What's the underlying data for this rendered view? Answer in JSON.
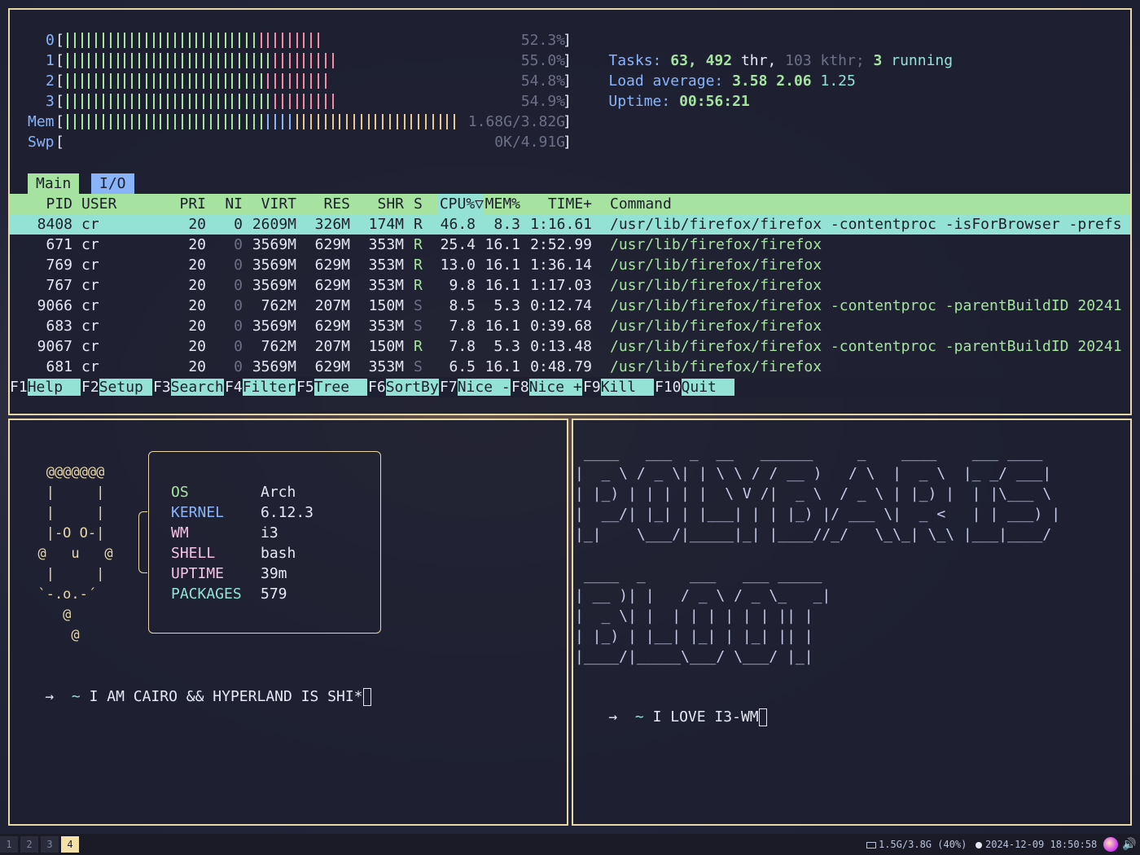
{
  "htop": {
    "cpus": [
      {
        "label": "0",
        "percent": "52.3%"
      },
      {
        "label": "1",
        "percent": "55.0%"
      },
      {
        "label": "2",
        "percent": "54.8%"
      },
      {
        "label": "3",
        "percent": "54.9%"
      }
    ],
    "mem": {
      "label": "Mem",
      "value": "1.68G/3.82G"
    },
    "swp": {
      "label": "Swp",
      "value": "0K/4.91G"
    },
    "tasks": {
      "label": "Tasks:",
      "count": "63,",
      "thr": "492",
      "thr_label": "thr,",
      "kthr": "103 kthr;",
      "running": "3",
      "running_label": "running"
    },
    "load": {
      "label": "Load average:",
      "one": "3.58",
      "five": "2.06",
      "fifteen": "1.25"
    },
    "uptime": {
      "label": "Uptime:",
      "value": "00:56:21"
    },
    "tabs": [
      "Main",
      "I/O"
    ],
    "columns": {
      "pid": "PID",
      "user": "USER",
      "pri": "PRI",
      "ni": "NI",
      "virt": "VIRT",
      "res": "RES",
      "shr": "SHR",
      "s": "S",
      "cpu": "CPU%▽",
      "mem": "MEM%",
      "time": "TIME+",
      "cmd": "Command"
    },
    "processes": [
      {
        "pid": "8408",
        "user": "cr",
        "pri": "20",
        "ni": "0",
        "virt": "2609M",
        "res": "326M",
        "shr": "174M",
        "s": "R",
        "cpu": "46.8",
        "mem": "8.3",
        "time": "1:16.61",
        "cmd": "/usr/lib/firefox/firefox -contentproc -isForBrowser -prefs"
      },
      {
        "pid": "671",
        "user": "cr",
        "pri": "20",
        "ni": "0",
        "virt": "3569M",
        "res": "629M",
        "shr": "353M",
        "s": "R",
        "cpu": "25.4",
        "mem": "16.1",
        "time": "2:52.99",
        "cmd": "/usr/lib/firefox/firefox"
      },
      {
        "pid": "769",
        "user": "cr",
        "pri": "20",
        "ni": "0",
        "virt": "3569M",
        "res": "629M",
        "shr": "353M",
        "s": "R",
        "cpu": "13.0",
        "mem": "16.1",
        "time": "1:36.14",
        "cmd": "/usr/lib/firefox/firefox"
      },
      {
        "pid": "767",
        "user": "cr",
        "pri": "20",
        "ni": "0",
        "virt": "3569M",
        "res": "629M",
        "shr": "353M",
        "s": "R",
        "cpu": "9.8",
        "mem": "16.1",
        "time": "1:17.03",
        "cmd": "/usr/lib/firefox/firefox"
      },
      {
        "pid": "9066",
        "user": "cr",
        "pri": "20",
        "ni": "0",
        "virt": "762M",
        "res": "207M",
        "shr": "150M",
        "s": "S",
        "cpu": "8.5",
        "mem": "5.3",
        "time": "0:12.74",
        "cmd": "/usr/lib/firefox/firefox -contentproc -parentBuildID 20241"
      },
      {
        "pid": "683",
        "user": "cr",
        "pri": "20",
        "ni": "0",
        "virt": "3569M",
        "res": "629M",
        "shr": "353M",
        "s": "S",
        "cpu": "7.8",
        "mem": "16.1",
        "time": "0:39.68",
        "cmd": "/usr/lib/firefox/firefox"
      },
      {
        "pid": "9067",
        "user": "cr",
        "pri": "20",
        "ni": "0",
        "virt": "762M",
        "res": "207M",
        "shr": "150M",
        "s": "R",
        "cpu": "7.8",
        "mem": "5.3",
        "time": "0:13.48",
        "cmd": "/usr/lib/firefox/firefox -contentproc -parentBuildID 20241"
      },
      {
        "pid": "681",
        "user": "cr",
        "pri": "20",
        "ni": "0",
        "virt": "3569M",
        "res": "629M",
        "shr": "353M",
        "s": "S",
        "cpu": "6.5",
        "mem": "16.1",
        "time": "0:48.79",
        "cmd": "/usr/lib/firefox/firefox"
      }
    ],
    "fkeys": [
      {
        "key": "F1",
        "label": "Help  "
      },
      {
        "key": "F2",
        "label": "Setup "
      },
      {
        "key": "F3",
        "label": "Search"
      },
      {
        "key": "F4",
        "label": "Filter"
      },
      {
        "key": "F5",
        "label": "Tree  "
      },
      {
        "key": "F6",
        "label": "SortBy"
      },
      {
        "key": "F7",
        "label": "Nice -"
      },
      {
        "key": "F8",
        "label": "Nice +"
      },
      {
        "key": "F9",
        "label": "Kill  "
      },
      {
        "key": "F10",
        "label": "Quit  "
      }
    ]
  },
  "neofetch": {
    "ascii": [
      "   @@@@@@@",
      "   |     |",
      "   |     |",
      "   |-O O-|",
      "  @   u   @",
      "   |     |",
      "  `-.o.-´",
      "     @",
      "      @"
    ],
    "info": [
      {
        "key": "OS",
        "value": "Arch",
        "color": "#a6e3a1"
      },
      {
        "key": "KERNEL",
        "value": "6.12.3",
        "color": "#89b4fa"
      },
      {
        "key": "WM",
        "value": "i3",
        "color": "#f5c2e7"
      },
      {
        "key": "SHELL",
        "value": "bash",
        "color": "#f5c2e7"
      },
      {
        "key": "UPTIME",
        "value": "39m",
        "color": "#f5c2e7"
      },
      {
        "key": "PACKAGES",
        "value": "579",
        "color": "#94e2d5"
      }
    ],
    "prompt_arrow": "→",
    "prompt_dir": "~",
    "prompt_text": "I AM CAIRO && HYPERLAND IS SHI*"
  },
  "figlet": {
    "line1": [
      " ____   ___  _  __   ______     _    ____    ___ ____",
      "|  _ \\ / _ \\| | \\ \\ / / __ )   / \\  |  _ \\  |_ _/ ___|",
      "| |_) | | | | |  \\ V /|  _ \\  / _ \\ | |_) |  | |\\___ \\",
      "|  __/| |_| | |___| | | |_) |/ ___ \\|  _ <   | | ___) |",
      "|_|    \\___/|_____|_| |____//_/   \\_\\_| \\_\\ |___|____/"
    ],
    "line2": [
      " ____  _     ___   ___ _____",
      "| __ )| |   / _ \\ / _ \\_   _|",
      "|  _ \\| |  | | | | | | || |",
      "| |_) | |__| |_| | |_| || |",
      "|____/|_____\\___/ \\___/ |_|"
    ],
    "prompt_arrow": "→",
    "prompt_dir": "~",
    "prompt_text": "I LOVE I3-WM"
  },
  "taskbar": {
    "workspaces": [
      "1",
      "2",
      "3",
      "4"
    ],
    "active_workspace": "4",
    "memory": "1.5G/3.8G (40%)",
    "datetime": "2024-12-09 18:50:58"
  }
}
